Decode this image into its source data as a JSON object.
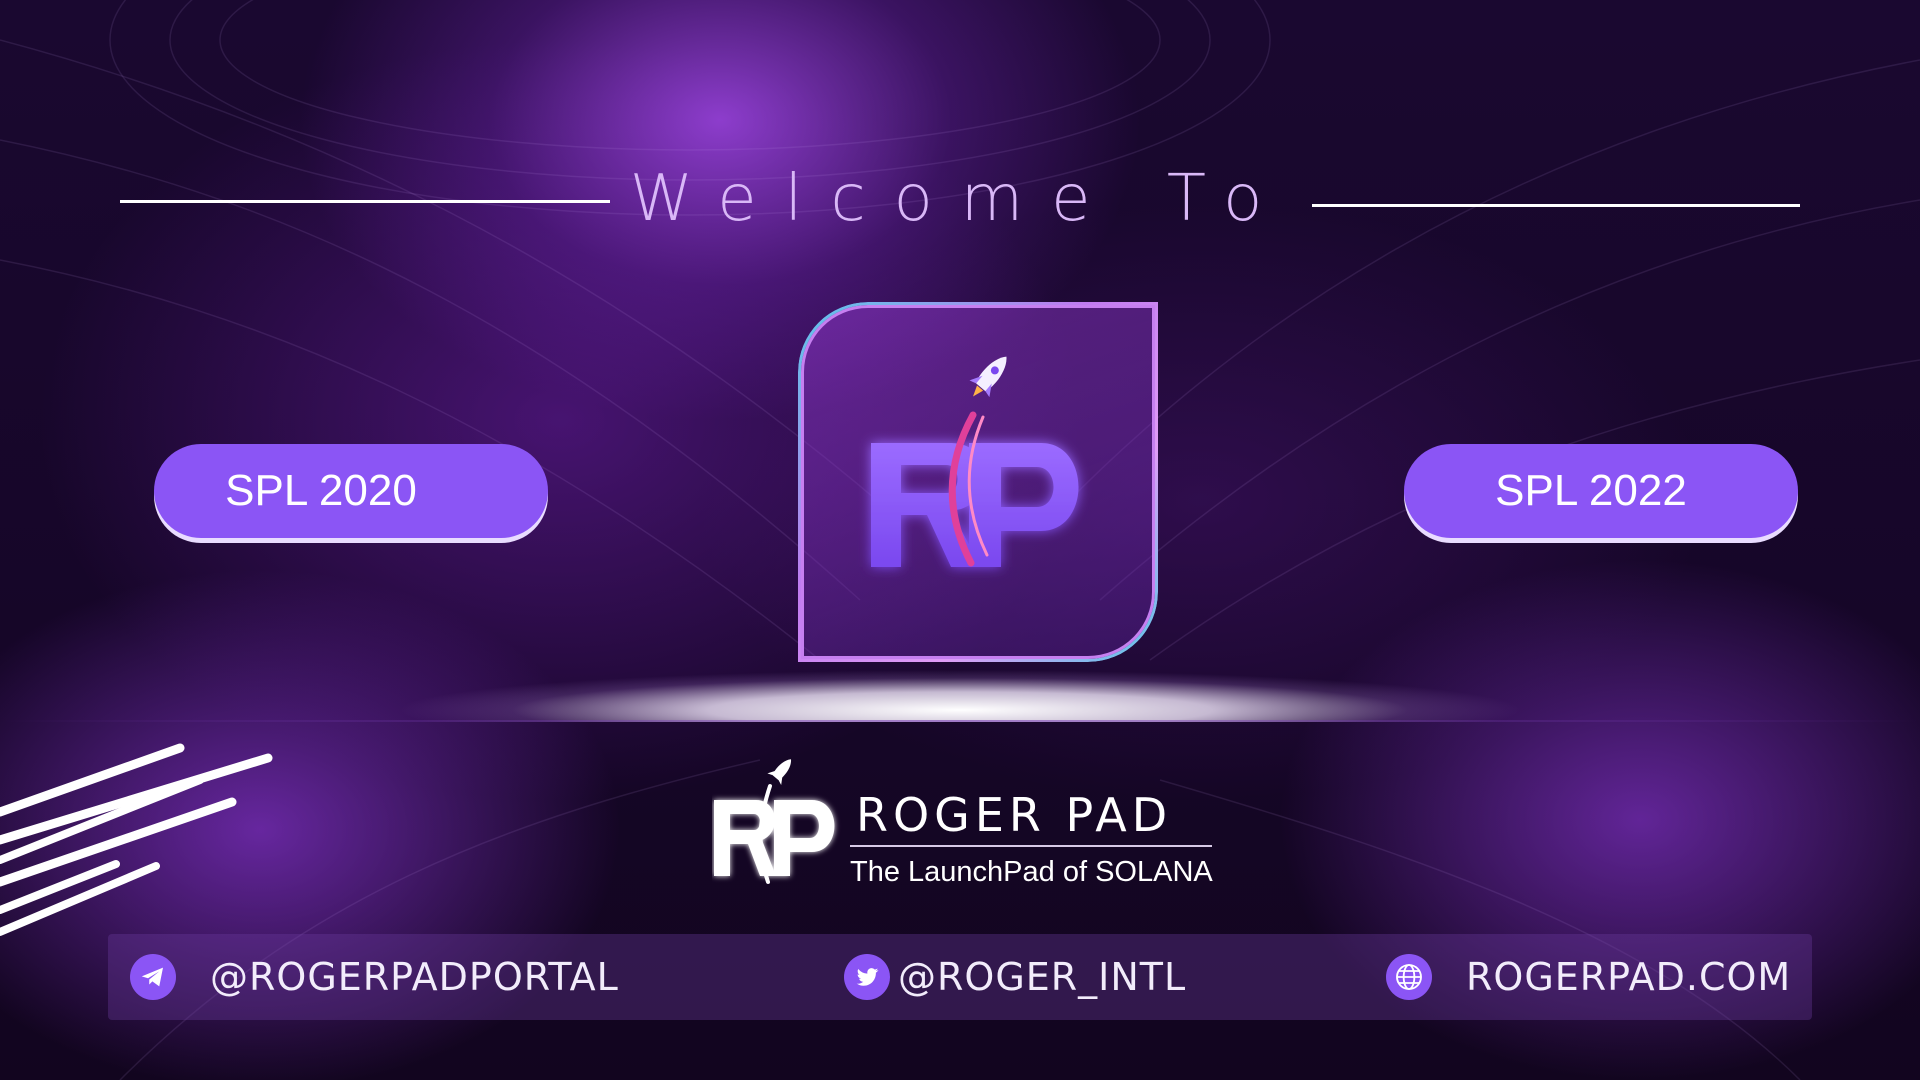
{
  "hero": {
    "heading": "Welcome To",
    "left_button_label": "SPL 2020",
    "right_button_label": "SPL 2022"
  },
  "brand": {
    "logo_icon": "rp-rocket-logo",
    "name": "ROGER PAD",
    "tagline": "The LaunchPad of SOLANA"
  },
  "footer": {
    "telegram": {
      "icon": "telegram-icon",
      "label": "@ROGERPADPORTAL"
    },
    "twitter": {
      "icon": "twitter-icon",
      "label": "@ROGER_INTL"
    },
    "website": {
      "icon": "globe-icon",
      "label": "ROGERPAD.COM"
    }
  },
  "colors": {
    "accent": "#8b55f5",
    "heading_text": "#d9b8f7",
    "background": "#12051f"
  }
}
